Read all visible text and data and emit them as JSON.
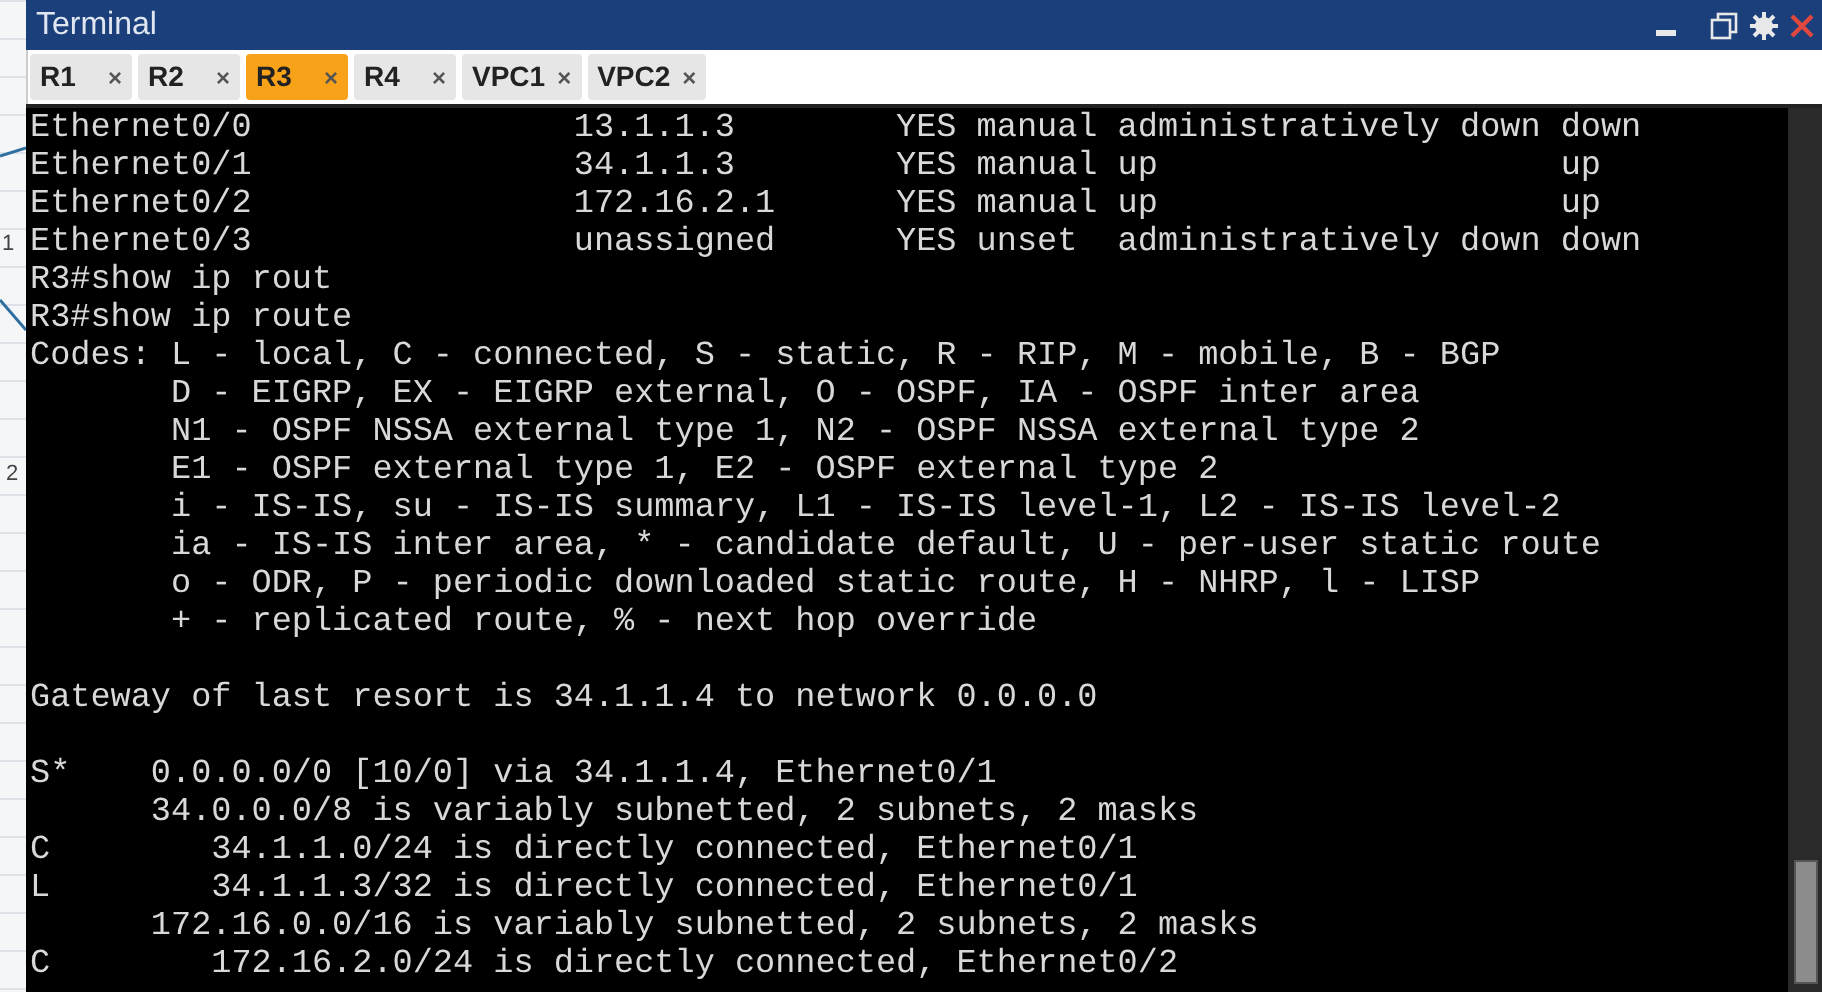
{
  "window": {
    "title": "Terminal"
  },
  "canvas_labels": [
    "1",
    "2"
  ],
  "tabs": [
    {
      "label": "R1",
      "close": "×",
      "selected": false
    },
    {
      "label": "R2",
      "close": "×",
      "selected": false
    },
    {
      "label": "R3",
      "close": "×",
      "selected": true
    },
    {
      "label": "R4",
      "close": "×",
      "selected": false
    },
    {
      "label": "VPC1",
      "close": "×",
      "selected": false
    },
    {
      "label": "VPC2",
      "close": "×",
      "selected": false
    }
  ],
  "terminal": {
    "blocks": [
      [
        "Ethernet0/0                13.1.1.3        YES manual administratively down down",
        "Ethernet0/1                34.1.1.3        YES manual up                    up",
        "Ethernet0/2                172.16.2.1      YES manual up                    up",
        "Ethernet0/3                unassigned      YES unset  administratively down down",
        "R3#show ip rout",
        "R3#show ip route",
        "Codes: L - local, C - connected, S - static, R - RIP, M - mobile, B - BGP",
        "       D - EIGRP, EX - EIGRP external, O - OSPF, IA - OSPF inter area",
        "       N1 - OSPF NSSA external type 1, N2 - OSPF NSSA external type 2",
        "       E1 - OSPF external type 1, E2 - OSPF external type 2",
        "       i - IS-IS, su - IS-IS summary, L1 - IS-IS level-1, L2 - IS-IS level-2",
        "       ia - IS-IS inter area, * - candidate default, U - per-user static route",
        "       o - ODR, P - periodic downloaded static route, H - NHRP, l - LISP",
        "       + - replicated route, % - next hop override"
      ],
      [
        "Gateway of last resort is 34.1.1.4 to network 0.0.0.0"
      ],
      [
        "S*    0.0.0.0/0 [10/0] via 34.1.1.4, Ethernet0/1",
        "      34.0.0.0/8 is variably subnetted, 2 subnets, 2 masks",
        "C        34.1.1.0/24 is directly connected, Ethernet0/1",
        "L        34.1.1.3/32 is directly connected, Ethernet0/1",
        "      172.16.0.0/16 is variably subnetted, 2 subnets, 2 masks",
        "C        172.16.2.0/24 is directly connected, Ethernet0/2"
      ]
    ]
  }
}
